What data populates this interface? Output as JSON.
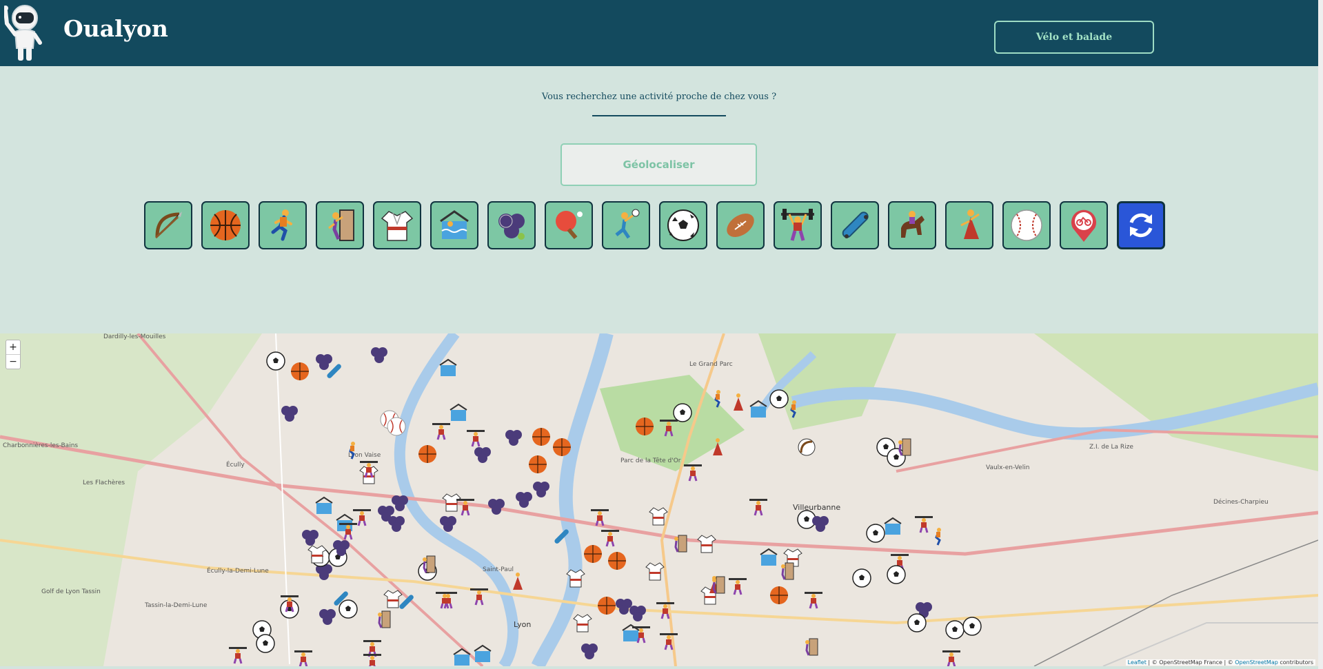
{
  "header": {
    "app_title": "Oualyon",
    "velo_button_label": "Vélo et balade",
    "logo_icon": "astronaut-icon"
  },
  "search": {
    "prompt": "Vous recherchez une activité proche de chez vous ?",
    "geolocate_label": "Géolocaliser"
  },
  "activities": [
    {
      "icon": "bow-arrow-icon"
    },
    {
      "icon": "basketball-icon"
    },
    {
      "icon": "running-icon"
    },
    {
      "icon": "climbing-icon"
    },
    {
      "icon": "martial-arts-uniform-icon"
    },
    {
      "icon": "swimming-pool-icon"
    },
    {
      "icon": "petanque-balls-icon"
    },
    {
      "icon": "ping-pong-icon"
    },
    {
      "icon": "handball-icon"
    },
    {
      "icon": "soccer-ball-icon"
    },
    {
      "icon": "rugby-ball-icon"
    },
    {
      "icon": "weightlifting-icon"
    },
    {
      "icon": "skateboard-icon"
    },
    {
      "icon": "horse-riding-icon"
    },
    {
      "icon": "dancer-icon"
    },
    {
      "icon": "baseball-icon"
    },
    {
      "icon": "bike-location-icon"
    },
    {
      "icon": "refresh-icon"
    }
  ],
  "map": {
    "zoom_in": "+",
    "zoom_out": "−",
    "attribution": {
      "leaflet": "Leaflet",
      "sep1": " | © OpenStreetMap France | © ",
      "osm": "OpenStreetMap",
      "suffix": " contributors"
    },
    "labels": {
      "l1": "Dardilly-les-Mouilles",
      "l2": "Charbonnières-les-Bains",
      "l3": "Écully",
      "l4": "Écully-la-Demi-Lune",
      "l5": "Golf de Lyon Tassin",
      "l6": "Tassin-la-Demi-Lune",
      "l7": "Villeurbanne",
      "l8": "Parc de la Tête d'Or",
      "l9": "Lyon",
      "l10": "Vaulx-en-Velin",
      "l11": "Décines-Charpieu",
      "l12": "Z.I. de La Rize",
      "l13": "Lyon Vaise",
      "l14": "Saint-Paul",
      "l15": "Les Flachères",
      "l16": "Le Grand Parc"
    }
  },
  "colors": {
    "header_bg": "#134a5e",
    "page_bg": "#d3e4de",
    "activity_button_bg": "#7dc7a4",
    "refresh_button_bg": "#2a56d8",
    "accent_text": "#a4e3c6"
  }
}
